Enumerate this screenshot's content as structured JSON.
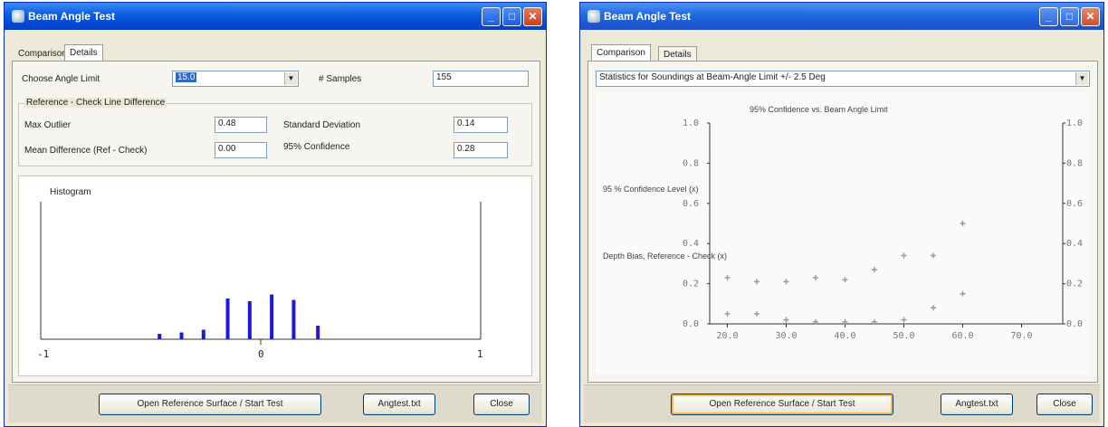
{
  "left_window": {
    "title": "Beam Angle Test",
    "tabs": [
      "Comparison",
      "Details"
    ],
    "active_tab": "Details",
    "angle_limit": {
      "label": "Choose Angle Limit",
      "value": "15.0"
    },
    "samples": {
      "label": "# Samples",
      "value": "155"
    },
    "group_title": "Reference - Check Line Difference",
    "stats": {
      "max_outlier": {
        "label": "Max Outlier",
        "value": "0.48"
      },
      "mean_difference": {
        "label": "Mean Difference (Ref - Check)",
        "value": "0.00"
      },
      "std_dev": {
        "label": "Standard Deviation",
        "value": "0.14"
      },
      "confidence_95": {
        "label": "95% Confidence",
        "value": "0.28"
      }
    },
    "histogram": {
      "title": "Histogram",
      "axis_labels": [
        "-1",
        "0",
        "1"
      ],
      "bar_color": "#1a1ad4",
      "bars": [
        {
          "x": -0.46,
          "h": 0.04
        },
        {
          "x": -0.36,
          "h": 0.05
        },
        {
          "x": -0.26,
          "h": 0.07
        },
        {
          "x": -0.15,
          "h": 0.3
        },
        {
          "x": -0.05,
          "h": 0.28
        },
        {
          "x": 0.05,
          "h": 0.33
        },
        {
          "x": 0.15,
          "h": 0.29
        },
        {
          "x": 0.26,
          "h": 0.1
        }
      ]
    },
    "buttons": {
      "open": "Open Reference Surface / Start Test",
      "angtest": "Angtest.txt",
      "close": "Close"
    }
  },
  "right_window": {
    "title": "Beam Angle Test",
    "tabs": [
      "Comparison",
      "Details"
    ],
    "active_tab": "Comparison",
    "stat_selector": "Statistics for Soundings at Beam-Angle Limit +/- 2.5 Deg",
    "chart_data": {
      "type": "scatter",
      "title": "95% Confidence vs. Beam Angle Limit",
      "left_labels": [
        "95 % Confidence Level (x)",
        "Depth Bias, Reference - Check (x)"
      ],
      "xlim": [
        17,
        77
      ],
      "ylim": [
        0.0,
        1.0
      ],
      "x_ticks": [
        "20.0",
        "30.0",
        "40.0",
        "50.0",
        "60.0",
        "70.0"
      ],
      "y_ticks": [
        "0.0",
        "0.2",
        "0.4",
        "0.6",
        "0.8",
        "1.0"
      ],
      "series": [
        {
          "x": [
            20,
            25,
            30,
            35,
            40,
            45,
            50,
            55,
            60
          ],
          "values": [
            0.23,
            0.21,
            0.21,
            0.23,
            0.22,
            0.27,
            0.34,
            0.34,
            0.5
          ]
        },
        {
          "x": [
            20,
            25,
            30,
            35,
            40,
            45,
            50,
            55,
            60
          ],
          "values": [
            0.05,
            0.05,
            0.02,
            0.01,
            0.01,
            0.01,
            0.02,
            0.08,
            0.15
          ]
        }
      ],
      "point_color": "#9a9aa6"
    },
    "buttons": {
      "open": "Open Reference Surface / Start Test",
      "angtest": "Angtest.txt",
      "close": "Close"
    }
  }
}
